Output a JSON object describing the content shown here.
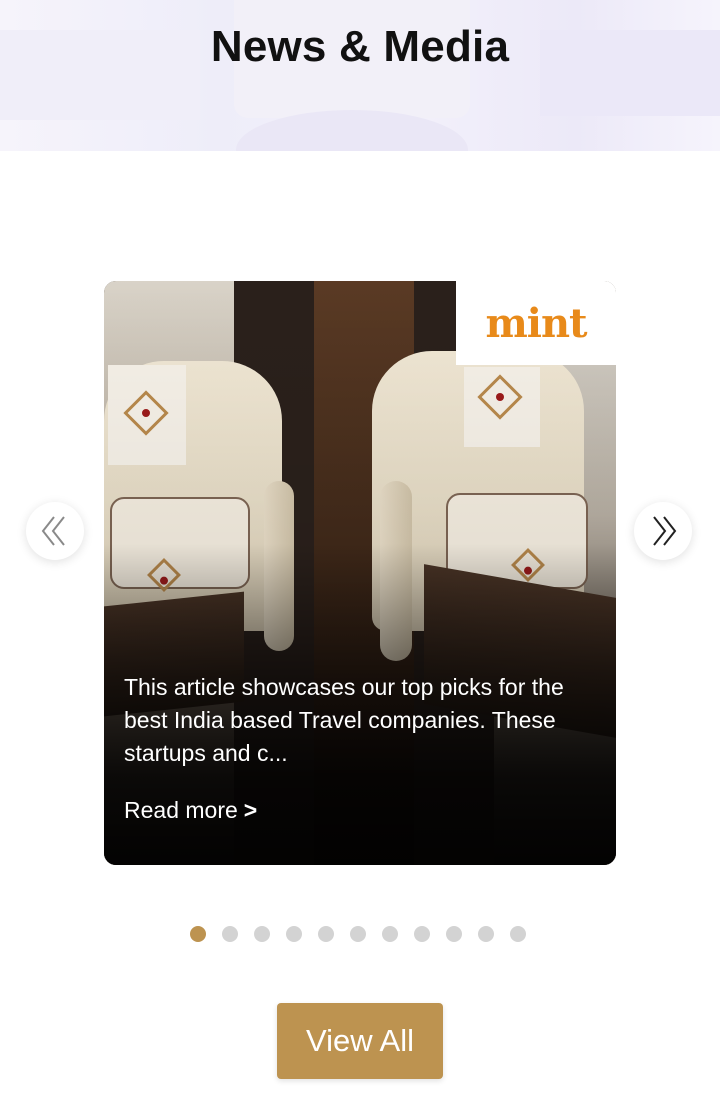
{
  "section": {
    "title": "News & Media"
  },
  "carousel": {
    "active_slide": {
      "publisher_logo_text": "mint",
      "description": "This article showcases our top picks for the best India based Travel companies. These startups and c...",
      "read_more_label": "Read more",
      "read_more_chevron": ">"
    },
    "prev_icon": "double-chevron-left-icon",
    "next_icon": "double-chevron-right-icon",
    "pagination": {
      "total": 11,
      "active_index": 0,
      "active_color": "#bd9350",
      "inactive_color": "#d3d3d3"
    }
  },
  "actions": {
    "view_all_label": "View All",
    "accent_color": "#bd9350"
  }
}
